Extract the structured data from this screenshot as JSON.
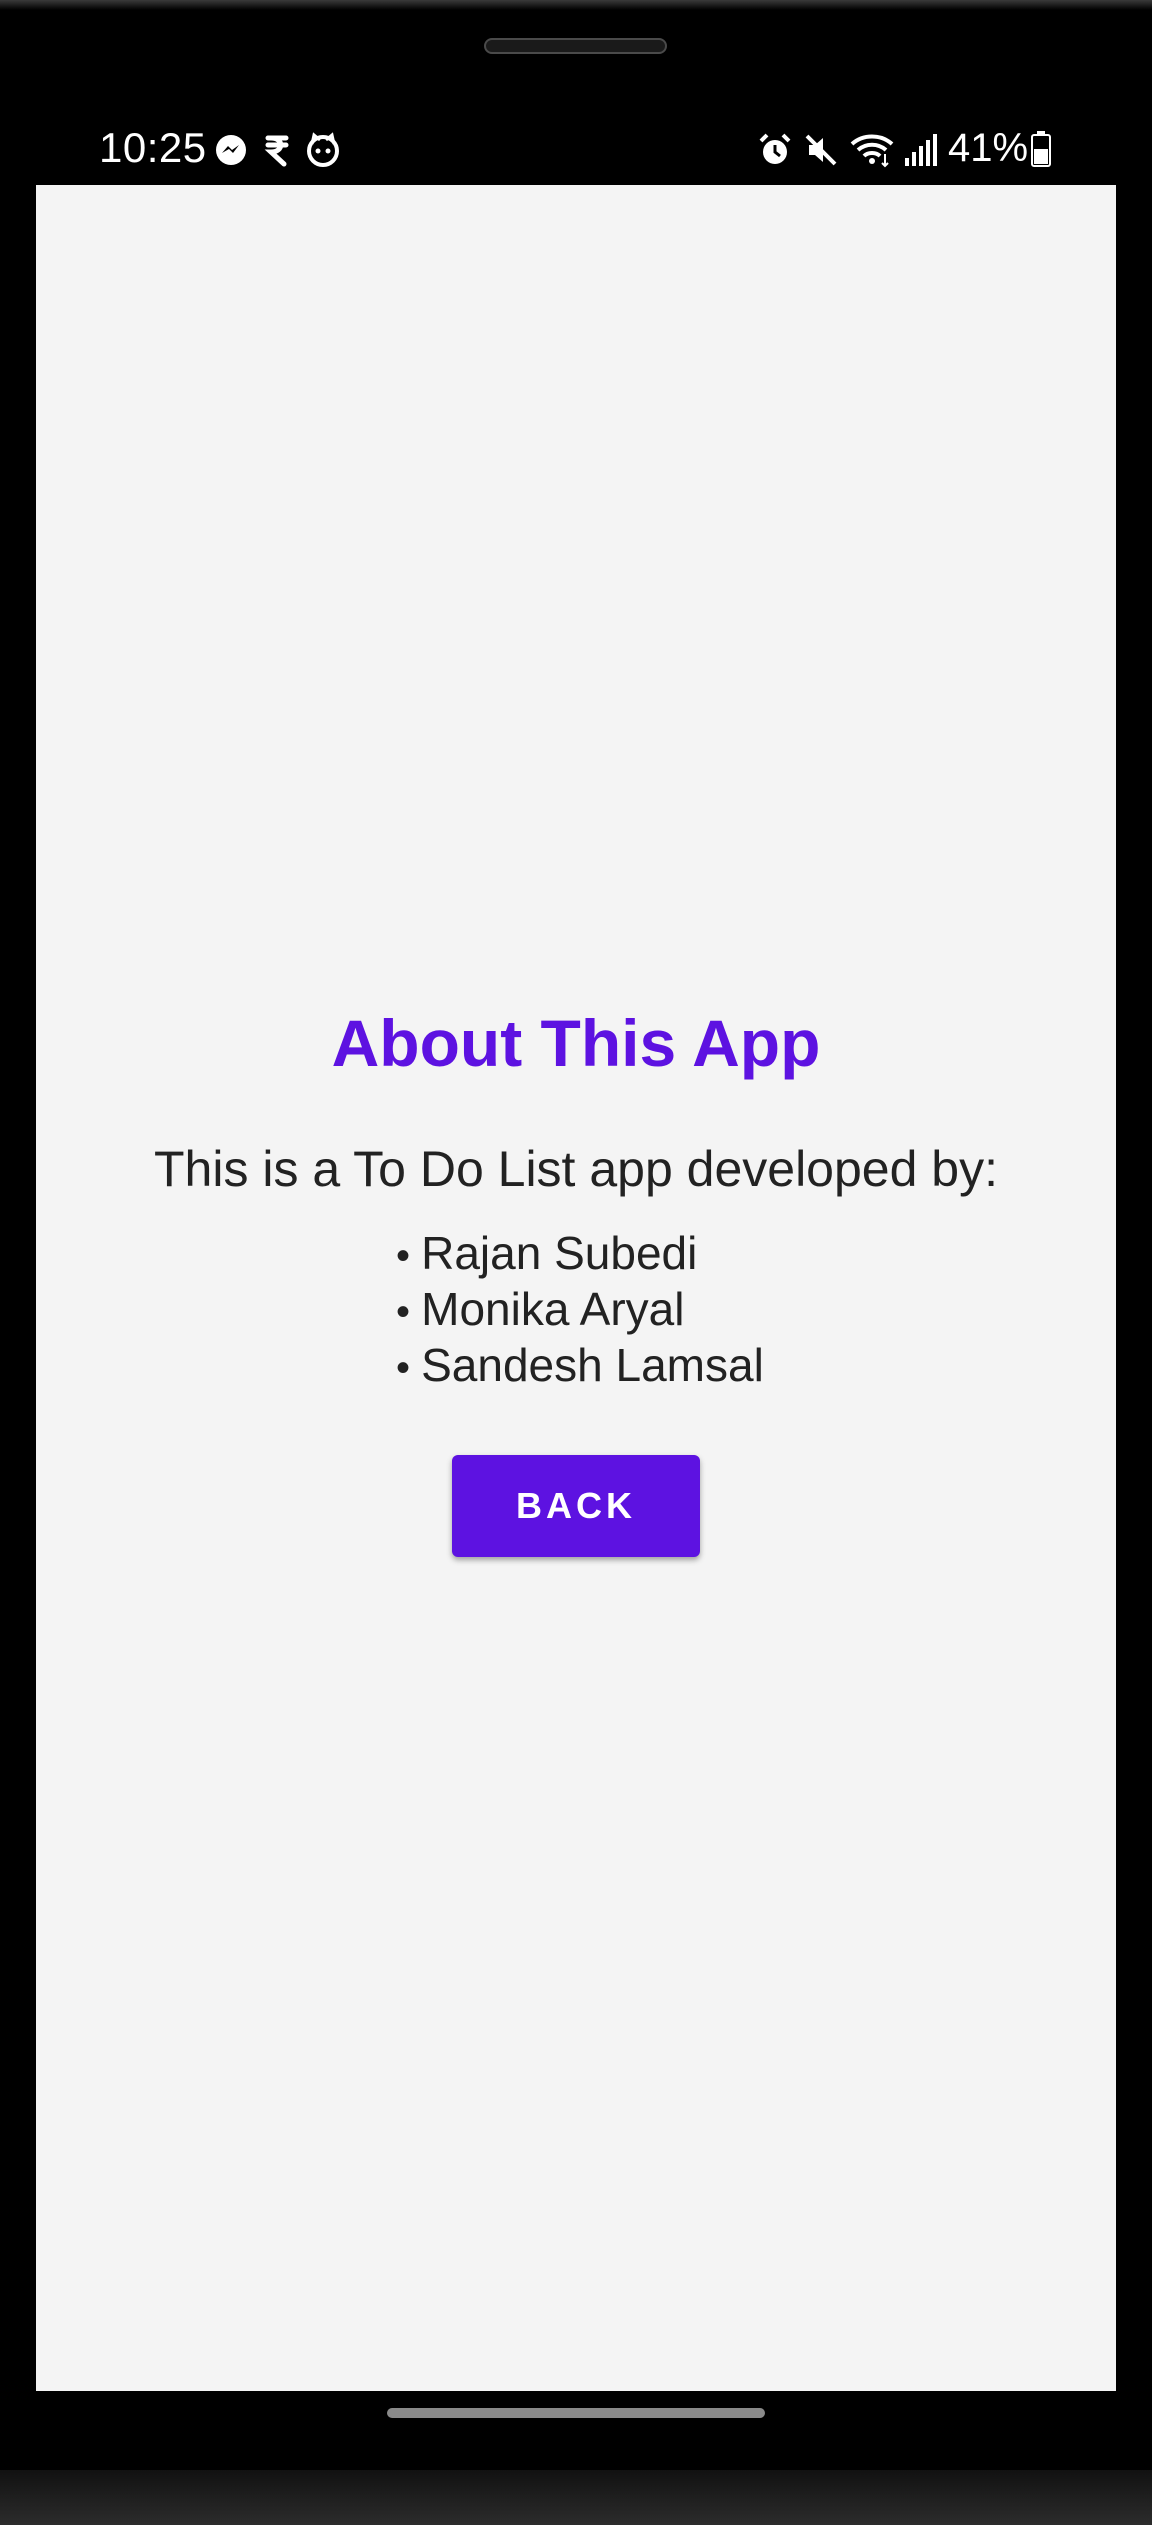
{
  "status_bar": {
    "time": "10:25",
    "left_icons": [
      "messenger-icon",
      "rupee-app-icon",
      "cat-face-icon"
    ],
    "right_icons": [
      "alarm-icon",
      "mute-icon",
      "wifi-icon",
      "signal-icon",
      "battery-icon"
    ],
    "battery_percent": "41%"
  },
  "about": {
    "title": "About This App",
    "intro": "This is a To Do List app developed by:",
    "developers": [
      "Rajan Subedi",
      "Monika Aryal",
      "Sandesh Lamsal"
    ],
    "back_label": "BACK"
  },
  "colors": {
    "accent": "#5d12e1",
    "screen_background": "#f4f4f4",
    "text": "#222222",
    "side_key": "#d9823a"
  }
}
